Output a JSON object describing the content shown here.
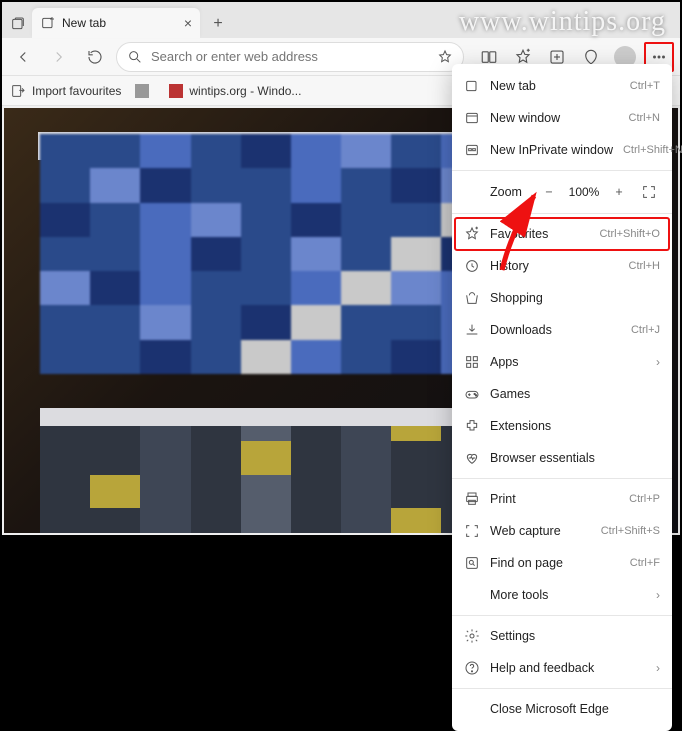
{
  "watermark": "www.wintips.org",
  "tab": {
    "title": "New tab"
  },
  "addressbar": {
    "placeholder": "Search or enter web address"
  },
  "bookmarks": {
    "import": "Import favourites",
    "item1": "",
    "item2": "wintips.org - Windo..."
  },
  "menu": {
    "new_tab": {
      "label": "New tab",
      "shortcut": "Ctrl+T"
    },
    "new_window": {
      "label": "New window",
      "shortcut": "Ctrl+N"
    },
    "new_inprivate": {
      "label": "New InPrivate window",
      "shortcut": "Ctrl+Shift+N"
    },
    "zoom": {
      "label": "Zoom",
      "value": "100%"
    },
    "favourites": {
      "label": "Favourites",
      "shortcut": "Ctrl+Shift+O"
    },
    "history": {
      "label": "History",
      "shortcut": "Ctrl+H"
    },
    "shopping": {
      "label": "Shopping"
    },
    "downloads": {
      "label": "Downloads",
      "shortcut": "Ctrl+J"
    },
    "apps": {
      "label": "Apps"
    },
    "games": {
      "label": "Games"
    },
    "extensions": {
      "label": "Extensions"
    },
    "browser_essentials": {
      "label": "Browser essentials"
    },
    "print": {
      "label": "Print",
      "shortcut": "Ctrl+P"
    },
    "web_capture": {
      "label": "Web capture",
      "shortcut": "Ctrl+Shift+S"
    },
    "find": {
      "label": "Find on page",
      "shortcut": "Ctrl+F"
    },
    "more_tools": {
      "label": "More tools"
    },
    "settings": {
      "label": "Settings"
    },
    "help": {
      "label": "Help and feedback"
    },
    "close": {
      "label": "Close Microsoft Edge"
    }
  }
}
